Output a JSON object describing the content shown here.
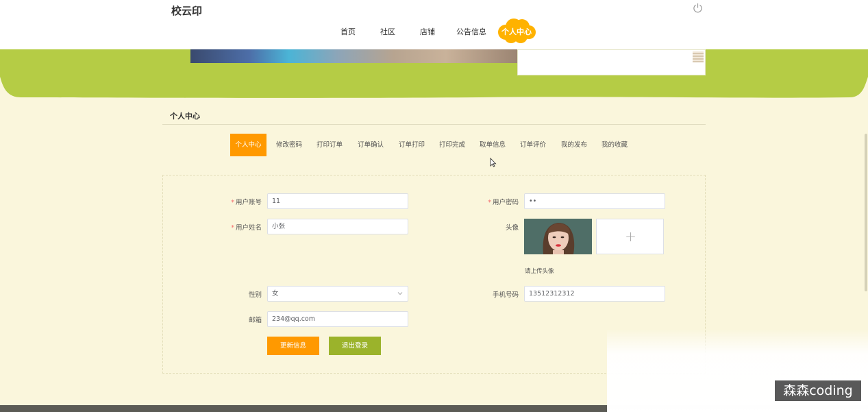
{
  "app": {
    "logo": "校云印",
    "icon_power": "power-icon"
  },
  "nav": {
    "items": [
      {
        "label": "首页"
      },
      {
        "label": "社区"
      },
      {
        "label": "店铺"
      },
      {
        "label": "公告信息"
      },
      {
        "label": "个人中心",
        "active": true
      }
    ]
  },
  "section": {
    "title": "个人中心"
  },
  "tabs": [
    {
      "label": "个人中心",
      "active": true
    },
    {
      "label": "修改密码"
    },
    {
      "label": "打印订单"
    },
    {
      "label": "订单确认"
    },
    {
      "label": "订单打印"
    },
    {
      "label": "打印完成"
    },
    {
      "label": "取单信息"
    },
    {
      "label": "订单评价"
    },
    {
      "label": "我的发布"
    },
    {
      "label": "我的收藏"
    }
  ],
  "form": {
    "account": {
      "label": "用户账号",
      "value": "11",
      "required": true
    },
    "password": {
      "label": "用户密码",
      "value": "••",
      "required": true
    },
    "name": {
      "label": "用户姓名",
      "value": "小张",
      "required": true
    },
    "avatar": {
      "label": "头像",
      "tip": "请上传头像",
      "plus": "+"
    },
    "gender": {
      "label": "性别",
      "value": "女"
    },
    "phone": {
      "label": "手机号码",
      "value": "13512312312"
    },
    "email": {
      "label": "邮箱",
      "value": "234@qq.com"
    },
    "required_mark": "*"
  },
  "buttons": {
    "update": "更新信息",
    "logout": "退出登录"
  },
  "watermark": "森森coding",
  "colors": {
    "accent_orange": "#ff9900",
    "accent_green": "#9bb32b",
    "hero_green": "#b5cc45",
    "page_bg": "#faf6dc"
  }
}
